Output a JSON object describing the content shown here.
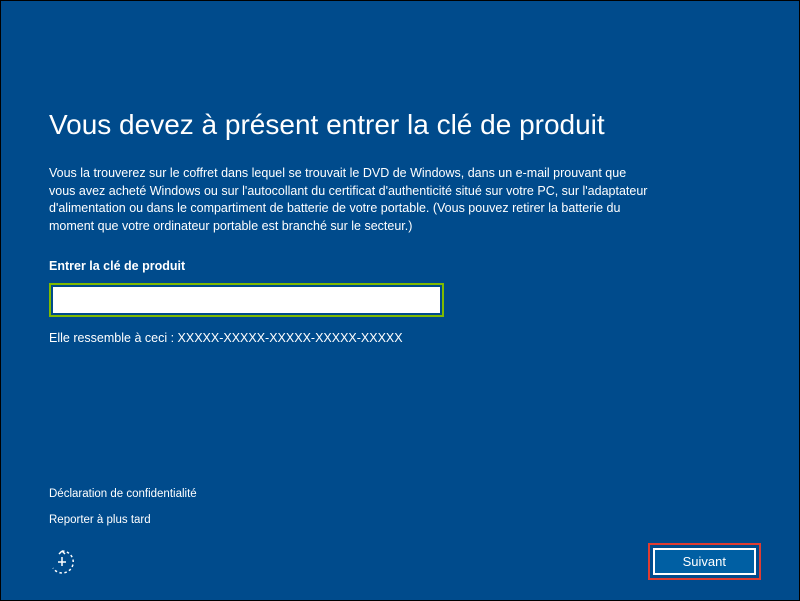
{
  "title": "Vous devez à présent entrer la clé de produit",
  "description": "Vous la trouverez sur le coffret dans lequel se trouvait le DVD de Windows, dans un e-mail prouvant que vous avez acheté Windows ou sur l'autocollant du certificat d'authenticité situé sur votre PC, sur l'adaptateur d'alimentation ou dans le compartiment de batterie de votre portable. (Vous pouvez retirer la batterie du moment que votre ordinateur portable est branché sur le secteur.)",
  "input_label": "Entrer la clé de produit",
  "input_value": "",
  "input_placeholder": "",
  "hint_text": "Elle ressemble à ceci : XXXXX-XXXXX-XXXXX-XXXXX-XXXXX",
  "links": {
    "privacy": "Déclaration de confidentialité",
    "skip": "Reporter à plus tard"
  },
  "next_button": "Suivant",
  "colors": {
    "background": "#004b8c",
    "highlight_green": "#7fba00",
    "highlight_red": "#e03c31",
    "button_bg": "#005fa3"
  }
}
